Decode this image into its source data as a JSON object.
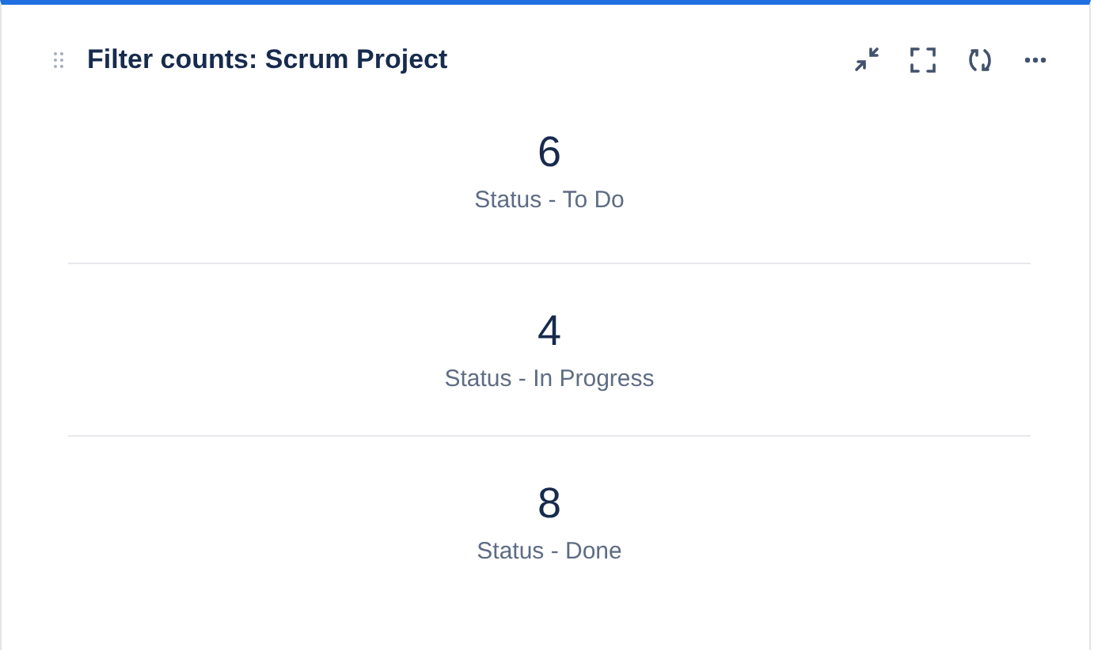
{
  "gadget": {
    "title": "Filter counts: Scrum Project"
  },
  "counts": [
    {
      "value": "6",
      "label": "Status - To Do"
    },
    {
      "value": "4",
      "label": "Status - In Progress"
    },
    {
      "value": "8",
      "label": "Status - Done"
    }
  ]
}
